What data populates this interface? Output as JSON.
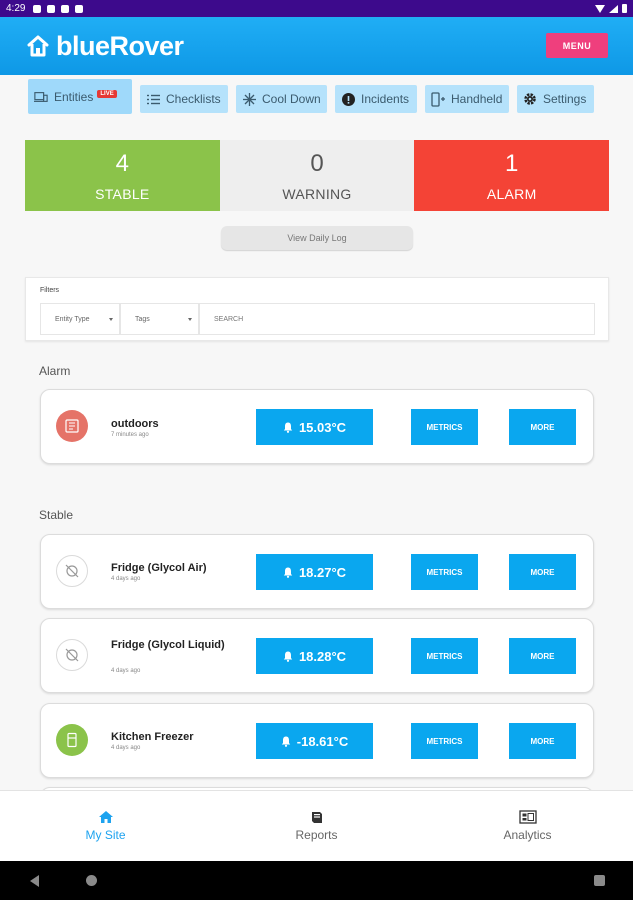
{
  "status_bar": {
    "time": "4:29"
  },
  "app": {
    "title": "blueRover",
    "menu_label": "MENU"
  },
  "tabs": [
    {
      "label": "Entities",
      "badge": "LIVE",
      "icon": "devices-icon"
    },
    {
      "label": "Checklists",
      "icon": "list-icon"
    },
    {
      "label": "Cool Down",
      "icon": "snowflake-icon"
    },
    {
      "label": "Incidents",
      "icon": "alert-circle-icon"
    },
    {
      "label": "Handheld",
      "icon": "handheld-icon"
    },
    {
      "label": "Settings",
      "icon": "gear-icon"
    }
  ],
  "summary": {
    "stable": {
      "count": "4",
      "label": "STABLE"
    },
    "warning": {
      "count": "0",
      "label": "WARNING"
    },
    "alarm": {
      "count": "1",
      "label": "ALARM"
    }
  },
  "daily_log_label": "View Daily Log",
  "filters": {
    "title": "Filters",
    "entity_type": "Entity Type",
    "tags": "Tags",
    "search_placeholder": "SEARCH"
  },
  "sections": {
    "alarm_title": "Alarm",
    "stable_title": "Stable"
  },
  "alarm_entities": [
    {
      "name": "outdoors",
      "time": "7 minutes ago",
      "temp": "15.03°C",
      "metrics": "METRICS",
      "more": "MORE"
    }
  ],
  "stable_entities": [
    {
      "name": "Fridge (Glycol Air)",
      "time": "4 days ago",
      "temp": "18.27°C",
      "metrics": "METRICS",
      "more": "MORE"
    },
    {
      "name": "Fridge (Glycol Liquid)",
      "time": "4 days ago",
      "temp": "18.28°C",
      "metrics": "METRICS",
      "more": "MORE"
    },
    {
      "name": "Kitchen Freezer",
      "time": "4 days ago",
      "temp": "-18.61°C",
      "metrics": "METRICS",
      "more": "MORE"
    }
  ],
  "bottom_nav": [
    {
      "label": "My Site",
      "active": true
    },
    {
      "label": "Reports",
      "active": false
    },
    {
      "label": "Analytics",
      "active": false
    }
  ],
  "colors": {
    "primary": "#0aa7ef",
    "stable": "#8bc34a",
    "warning": "#eeeeee",
    "alarm": "#f44336",
    "menu": "#ef3f7d"
  }
}
